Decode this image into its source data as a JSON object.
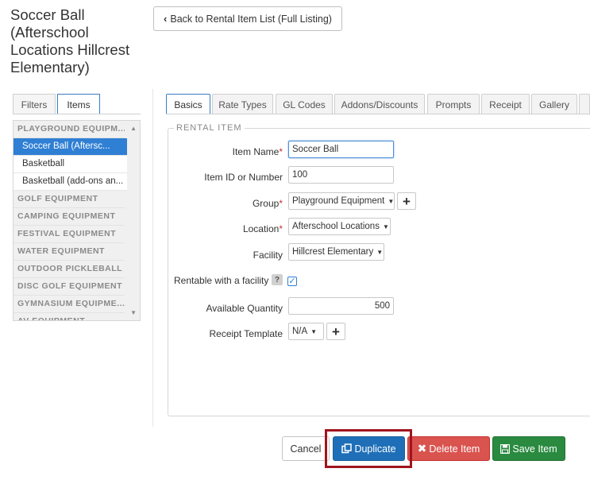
{
  "page": {
    "title": "Soccer Ball (Afterschool Locations Hillcrest Elementary)",
    "back_button": "Back to Rental Item List (Full Listing)"
  },
  "left_tabs": [
    "Filters",
    "Items"
  ],
  "left_list": {
    "selected_category": "PLAYGROUND EQUIPM...",
    "items": [
      "Soccer Ball (Aftersc...",
      "Basketball",
      "Basketball (add-ons an..."
    ],
    "categories": [
      "GOLF EQUIPMENT",
      "CAMPING EQUIPMENT",
      "FESTIVAL EQUIPMENT",
      "WATER EQUIPMENT",
      "OUTDOOR PICKLEBALL ...",
      "DISC GOLF EQUIPMENT",
      "GYMNASIUM EQUIPME...",
      "AV EQUIPMENT"
    ]
  },
  "tabs": [
    "Basics",
    "Rate Types",
    "GL Codes",
    "Addons/Discounts",
    "Prompts",
    "Receipt",
    "Gallery"
  ],
  "form": {
    "legend": "RENTAL ITEM",
    "item_name_label": "Item Name",
    "item_name_value": "Soccer Ball",
    "item_id_label": "Item ID or Number",
    "item_id_value": "100",
    "group_label": "Group",
    "group_value": "Playground Equipment",
    "location_label": "Location",
    "location_value": "Afterschool Locations",
    "facility_label": "Facility",
    "facility_value": "Hillcrest Elementary",
    "rentable_label": "Rentable with a facility",
    "rentable_checked": true,
    "quantity_label": "Available Quantity",
    "quantity_value": "500",
    "receipt_label": "Receipt Template",
    "receipt_value": "N/A",
    "required_mark": "*",
    "help_mark": "?"
  },
  "buttons": {
    "cancel": "Cancel",
    "duplicate": "Duplicate",
    "delete": "Delete Item",
    "save": "Save Item"
  },
  "colors": {
    "primary": "#1f6fb8",
    "danger": "#d9534f",
    "success": "#2a8a3f",
    "highlight": "#a0141e"
  },
  "icons": {
    "back": "chevron-left-icon",
    "edit": "pencil-icon",
    "add": "plus-icon",
    "duplicate": "copy-icon",
    "delete": "x-icon",
    "save": "floppy-disk-icon"
  }
}
